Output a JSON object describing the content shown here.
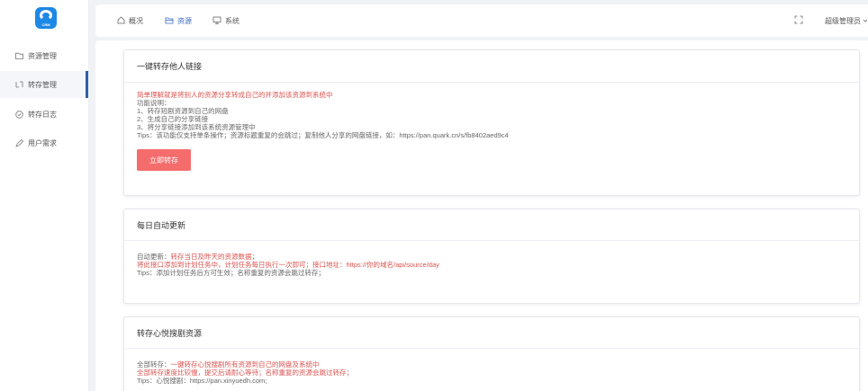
{
  "logo": {
    "text": "CRM"
  },
  "sidebar": {
    "items": [
      {
        "label": "资源管理",
        "icon": "folder-icon",
        "active": false
      },
      {
        "label": "转存管理",
        "icon": "transfer-icon",
        "active": true
      },
      {
        "label": "转存日志",
        "icon": "log-icon",
        "active": false
      },
      {
        "label": "用户需求",
        "icon": "edit-icon",
        "active": false
      }
    ]
  },
  "header": {
    "nav": [
      {
        "label": "概况",
        "icon": "home-icon"
      },
      {
        "label": "资源",
        "icon": "resource-icon",
        "active": true
      },
      {
        "label": "系统",
        "icon": "monitor-icon"
      }
    ],
    "user": "超级管理员",
    "colors": {
      "active": "#3b6cc4"
    }
  },
  "cards": [
    {
      "title": "一键转存他人链接",
      "lines": [
        "简单理解就是将别人的资源分享转成自己的并添加该资源到系统中",
        "功能说明：",
        "1、转存短剧资源到自己的网盘",
        "2、生成自己的分享链接",
        "3、将分享链接添加到该系统资源管理中",
        "Tips：该功能仅支持单条操作；资源标题重复的会跳过；复制他人分享的网盘链接，如：https://pan.quark.cn/s/fb8402aed9c4"
      ],
      "button": "立即转存"
    },
    {
      "title": "每日自动更新",
      "lines": [
        "自动更新：转存当日及昨天的资源数据；",
        "将此接口添加到计划任务中，计划任务每日执行一次即可；接口地址：https://你的域名/api/source/day",
        "Tips：添加计划任务后方可生效；名称重复的资源会跳过转存；"
      ]
    },
    {
      "title": "转存心悦搜剧资源",
      "lines": [
        "全部转存：一键转存心悦搜剧所有资源到自己的网盘及系统中",
        "全部转存速度比较慢，提交后请耐心等待；名称重复的资源会跳过转存；",
        "Tips：心悦搜剧：https://pan.xinyuedh.com;"
      ]
    }
  ],
  "colors": {
    "red": "#d9534f",
    "button": "#f56c6c",
    "sidebar_active_bar": "#2d5fa8"
  }
}
